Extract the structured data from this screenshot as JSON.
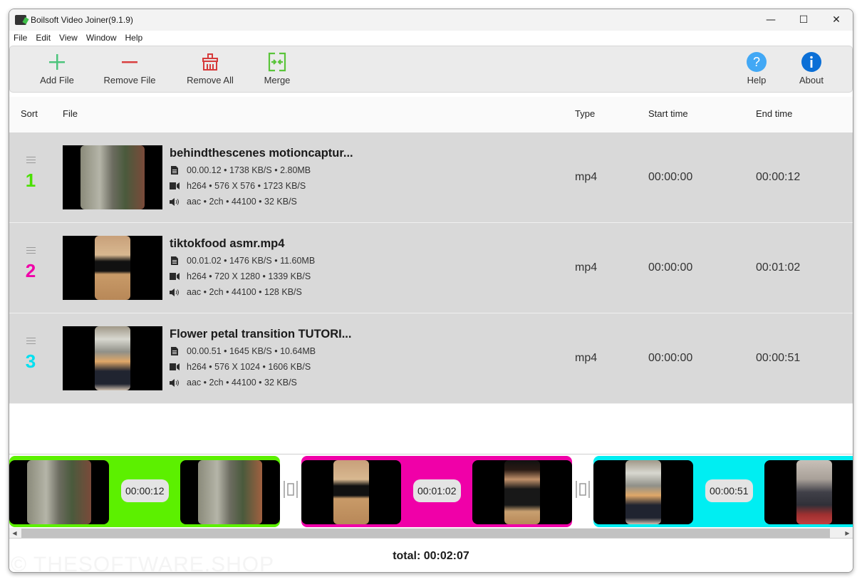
{
  "window": {
    "title": "Boilsoft Video Joiner(9.1.9)",
    "controls": {
      "minimize": "—",
      "maximize": "☐",
      "close": "✕"
    }
  },
  "menu": [
    "File",
    "Edit",
    "View",
    "Window",
    "Help"
  ],
  "toolbar": {
    "add_file": "Add File",
    "remove_file": "Remove File",
    "remove_all": "Remove All",
    "merge": "Merge",
    "help": "Help",
    "about": "About"
  },
  "columns": {
    "sort": "Sort",
    "file": "File",
    "type": "Type",
    "start_time": "Start time",
    "end_time": "End time"
  },
  "files": [
    {
      "index": "1",
      "color": "#4ae000",
      "name": "behindthescenes motioncaptur...",
      "file_info": "00.00.12 •  1738 KB/S • 2.80MB",
      "video_info": "h264 • 576 X 576 • 1723 KB/S",
      "audio_info": "aac • 2ch • 44100 • 32 KB/S",
      "type": "mp4",
      "start": "00:00:00",
      "end": "00:00:12"
    },
    {
      "index": "2",
      "color": "#f000a8",
      "name": "tiktokfood asmr.mp4",
      "file_info": "00.01.02 •  1476 KB/S • 11.60MB",
      "video_info": "h264 • 720 X 1280 • 1339 KB/S",
      "audio_info": "aac • 2ch • 44100 • 128 KB/S",
      "type": "mp4",
      "start": "00:00:00",
      "end": "00:01:02"
    },
    {
      "index": "3",
      "color": "#00e8f0",
      "name": "Flower petal transition TUTORI...",
      "file_info": "00.00.51 •  1645 KB/S • 10.64MB",
      "video_info": "h264 • 576 X 1024 • 1606 KB/S",
      "audio_info": "aac • 2ch • 44100 • 32 KB/S",
      "type": "mp4",
      "start": "00:00:00",
      "end": "00:00:51"
    }
  ],
  "timeline": [
    {
      "duration": "00:00:12",
      "color": "#5cf000"
    },
    {
      "duration": "00:01:02",
      "color": "#f000a8"
    },
    {
      "duration": "00:00:51",
      "color": "#00eef2"
    }
  ],
  "footer": {
    "total": "total: 00:02:07",
    "watermark": "© THESOFTWARE.SHOP"
  }
}
